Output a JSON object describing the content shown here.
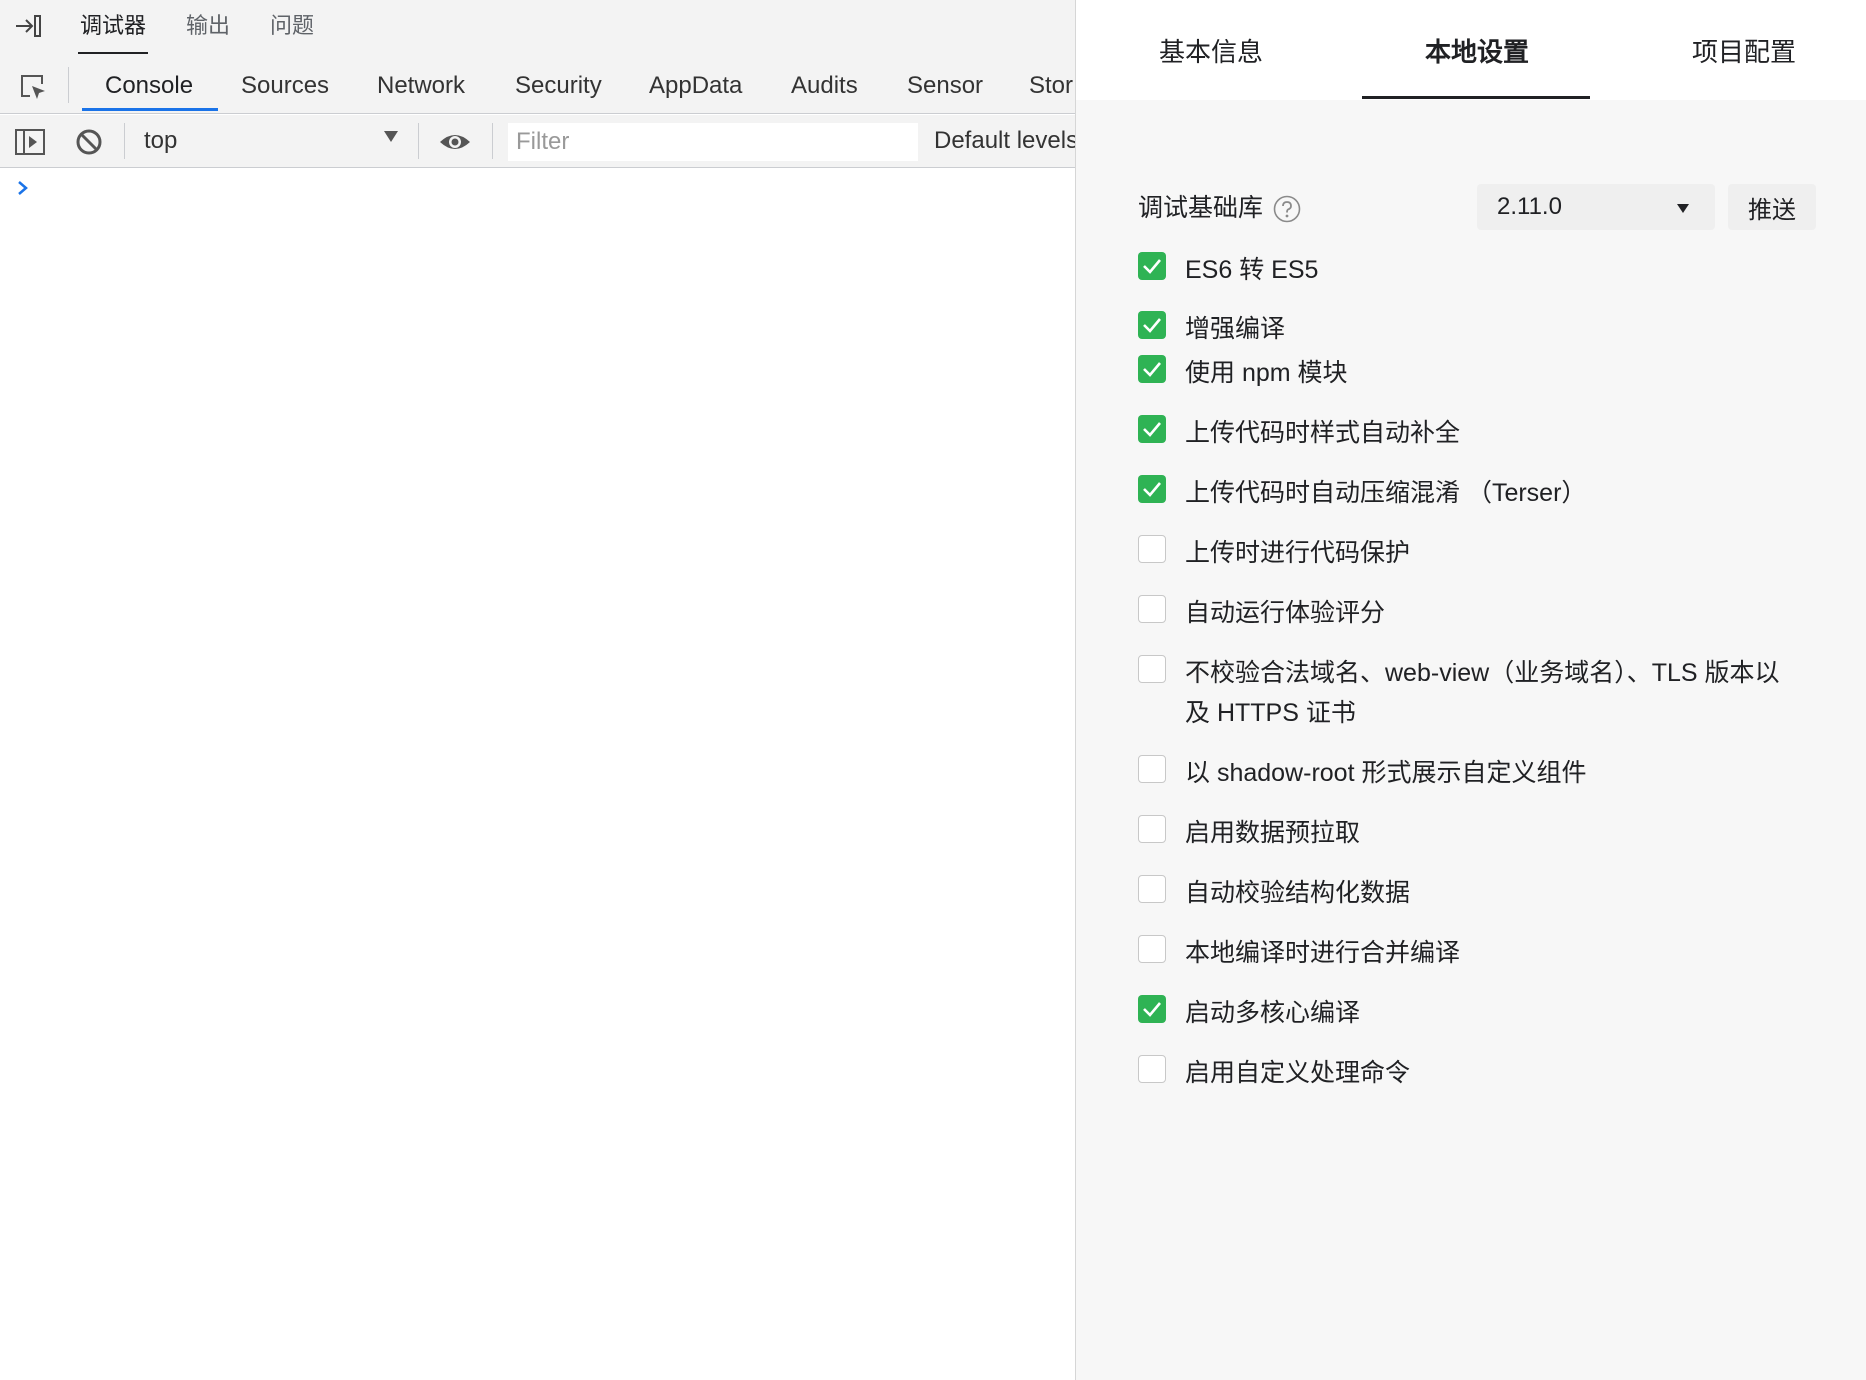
{
  "devtools": {
    "top_tabs": [
      "调试器",
      "输出",
      "问题"
    ],
    "active_top_tab": "调试器",
    "panel_tabs": [
      "Console",
      "Sources",
      "Network",
      "Security",
      "AppData",
      "Audits",
      "Sensor",
      "Stor"
    ],
    "active_panel_tab": "Console",
    "toolbar": {
      "context": "top",
      "filter_placeholder": "Filter",
      "levels": "Default levels"
    }
  },
  "settings": {
    "tabs": [
      "基本信息",
      "本地设置",
      "项目配置"
    ],
    "active_tab": "本地设置",
    "base_library": {
      "label": "调试基础库",
      "version": "2.11.0",
      "push_label": "推送"
    },
    "options": [
      {
        "label": "ES6 转 ES5",
        "checked": true
      },
      {
        "label": "增强编译",
        "checked": true
      },
      {
        "label": "使用 npm 模块",
        "checked": true
      },
      {
        "label": "上传代码时样式自动补全",
        "checked": true
      },
      {
        "label": "上传代码时自动压缩混淆 （Terser）",
        "checked": true
      },
      {
        "label": "上传时进行代码保护",
        "checked": false
      },
      {
        "label": "自动运行体验评分",
        "checked": false
      },
      {
        "label": "不校验合法域名、web-view（业务域名）、TLS 版本以及 HTTPS 证书",
        "checked": false
      },
      {
        "label": "以 shadow-root 形式展示自定义组件",
        "checked": false
      },
      {
        "label": "启用数据预拉取",
        "checked": false
      },
      {
        "label": "自动校验结构化数据",
        "checked": false
      },
      {
        "label": "本地编译时进行合并编译",
        "checked": false
      },
      {
        "label": "启动多核心编译",
        "checked": true
      },
      {
        "label": "启用自定义处理命令",
        "checked": false
      }
    ]
  },
  "colors": {
    "checkbox_checked": "#2fb354",
    "active_tab_underline": "#1a73e8",
    "console_prompt": "#1a73e8"
  }
}
